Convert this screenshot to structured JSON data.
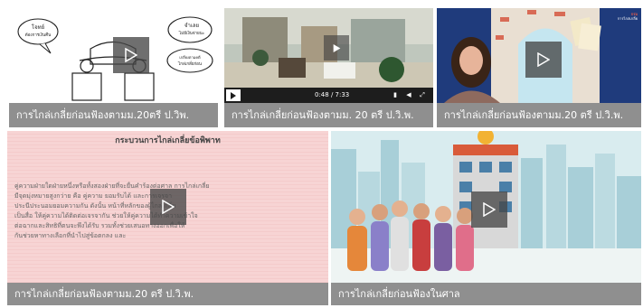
{
  "cards": [
    {
      "caption": "การไกล่เกลี่ยก่อนฟ้องตามม.20ตรี ป.วิพ.",
      "bubble_left": "โจทย์\nต้องการเงินคืน",
      "bubble_right_top": "จำเลย\nไม่มีเงินจ่ายนะ",
      "bubble_right_bottom": "เกลี่ยงตามคดี\nไกล่เกลี่ยก่อน"
    },
    {
      "caption": "การไกล่เกลี่ยก่อนฟ้องตามม. 20 ตรี ป.วิ.พ.",
      "time": "0:48 / 7:33"
    },
    {
      "caption": "การไกล่เกลี่ยก่อนฟ้องตามม.20 ตรี ป.วิ.พ.",
      "logo": "กรม\nการไกล่เกลี่ย"
    },
    {
      "caption": "การไกล่เกลี่ยก่อนฟ้องตามม.20 ตรี ป.วิ.พ.",
      "slide_title": "กระบวนการไกล่เกลี่ยข้อพิพาท",
      "slide_lines": [
        "คู่ความฝ่ายใดฝ่ายหนึ่งหรือทั้งสองฝ่ายที่จะยื่นคำร้องต่อศาล การไกล่เกลี่ย",
        "มีจุดมุ่งหมายสูงกว่าย คือ คู่ความ ยอมรับได้ และการเจรจา",
        "ประนีประนอมยอมความกัน ดังนั้น หน้าที่หลักของผู้ไกล่เกลี่ย",
        "เป็นสื่อ ให้คู่ความได้ติดต่อเจรจากัน ช่วยให้คู่ความได้ทำความเข้าใจ",
        "ต่อฉากและสิทธิที่ตนจะพึงได้รับ รวมทั้งช่วยเสนอทางออกเพื่อให้",
        "กันช่วยหาทางเลือกที่นำไปสู่ข้อตกลง และ"
      ]
    },
    {
      "caption": "การไกล่เกลี่ยก่อนฟ้องในศาล"
    }
  ],
  "icons": {
    "play": "play-icon"
  },
  "colors": {
    "caption_bg": "#8f8f8f",
    "overlay": "#464646"
  }
}
